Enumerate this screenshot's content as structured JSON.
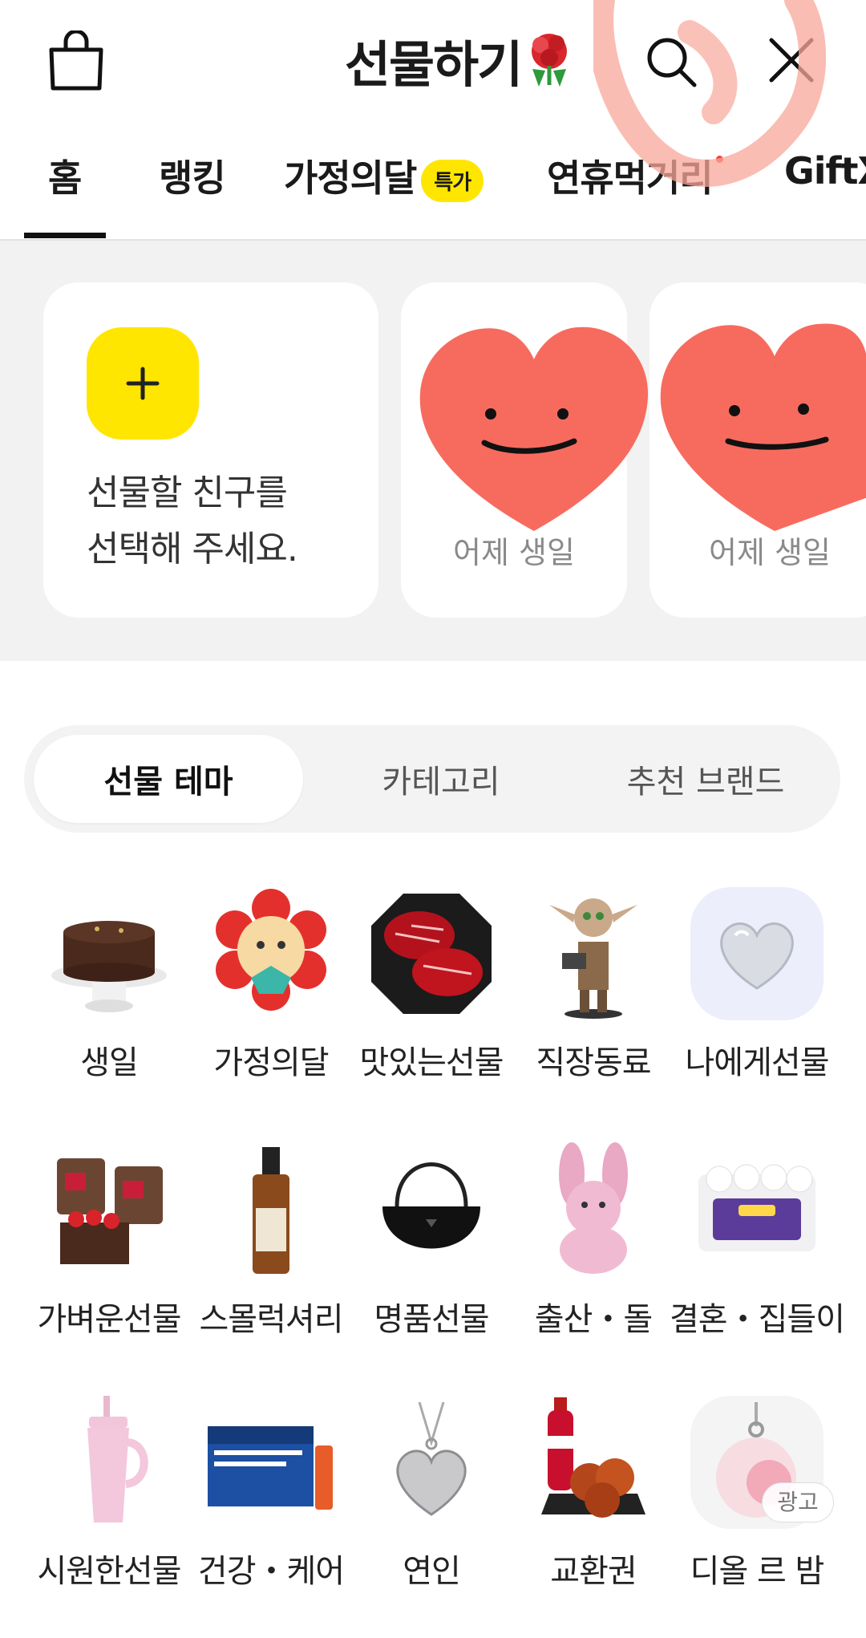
{
  "header": {
    "title": "선물하기"
  },
  "tabs": [
    {
      "label": "홈",
      "active": true
    },
    {
      "label": "랭킹"
    },
    {
      "label": "가정의달",
      "badge": "특가"
    },
    {
      "label": "연휴먹거리",
      "dot": true
    },
    {
      "label": "GiftX"
    }
  ],
  "friends": {
    "add_text_line1": "선물할 친구를",
    "add_text_line2": "선택해 주세요.",
    "cards": [
      {
        "birthday": "어제 생일"
      },
      {
        "birthday": "어제 생일"
      }
    ]
  },
  "segmented": {
    "options": [
      "선물 테마",
      "카테고리",
      "추천 브랜드"
    ],
    "selected": "선물 테마"
  },
  "themes": [
    {
      "label": "생일",
      "icon": "cake-icon"
    },
    {
      "label": "가정의달",
      "icon": "flower-cookie-icon"
    },
    {
      "label": "맛있는선물",
      "icon": "beef-icon"
    },
    {
      "label": "직장동료",
      "icon": "figure-icon"
    },
    {
      "label": "나에게선물",
      "icon": "silver-heart-icon"
    },
    {
      "label": "가벼운선물",
      "icon": "coffee-cake-icon"
    },
    {
      "label": "스몰럭셔리",
      "icon": "perfume-bottle-icon"
    },
    {
      "label": "명품선물",
      "icon": "handbag-icon"
    },
    {
      "label": "출산・돌",
      "icon": "bunny-plush-icon"
    },
    {
      "label": "결혼・집들이",
      "icon": "tissue-pack-icon"
    },
    {
      "label": "시원한선물",
      "icon": "tumbler-icon"
    },
    {
      "label": "건강・케어",
      "icon": "supplement-box-icon"
    },
    {
      "label": "연인",
      "icon": "heart-necklace-icon"
    },
    {
      "label": "교환권",
      "icon": "chicken-cola-icon"
    },
    {
      "label": "디올 르 밤",
      "icon": "dior-balm-icon"
    }
  ],
  "ad_badge": "광고",
  "colors": {
    "accent_yellow": "#ffe600",
    "heart_red": "#f76b5f",
    "background_gray": "#f2f2f2"
  }
}
